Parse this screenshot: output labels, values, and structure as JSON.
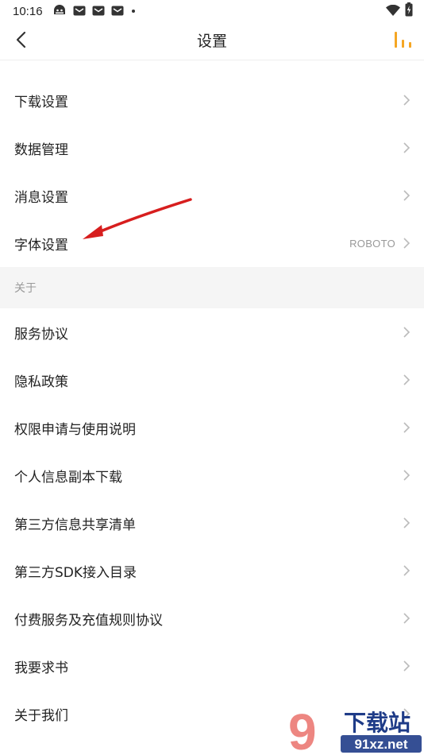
{
  "status_bar": {
    "time": "10:16",
    "icons": [
      "android-robot-icon",
      "mail-icon",
      "mail-icon",
      "mail-icon",
      "notification-dot-icon"
    ],
    "right_icons": [
      "wifi-icon",
      "battery-charging-icon"
    ]
  },
  "nav": {
    "title": "设置",
    "back_icon": "chevron-left-icon",
    "right_icon": "bar-chart-icon",
    "accent": "#f5a623"
  },
  "group1": [
    {
      "label": "下载设置",
      "value": ""
    },
    {
      "label": "数据管理",
      "value": ""
    },
    {
      "label": "消息设置",
      "value": ""
    },
    {
      "label": "字体设置",
      "value": "ROBOTO"
    }
  ],
  "section": {
    "label": "关于"
  },
  "group2": [
    {
      "label": "服务协议"
    },
    {
      "label": "隐私政策"
    },
    {
      "label": "权限申请与使用说明"
    },
    {
      "label": "个人信息副本下载"
    },
    {
      "label": "第三方信息共享清单"
    },
    {
      "label": "第三方SDK接入目录"
    },
    {
      "label": "付费服务及充值规则协议"
    },
    {
      "label": "我要求书"
    },
    {
      "label": "关于我们"
    }
  ],
  "annotation": {
    "arrow_color": "#d71e1e"
  },
  "watermark": {
    "logo_text": "下载站",
    "site": "91xz.net",
    "mark": "9"
  }
}
